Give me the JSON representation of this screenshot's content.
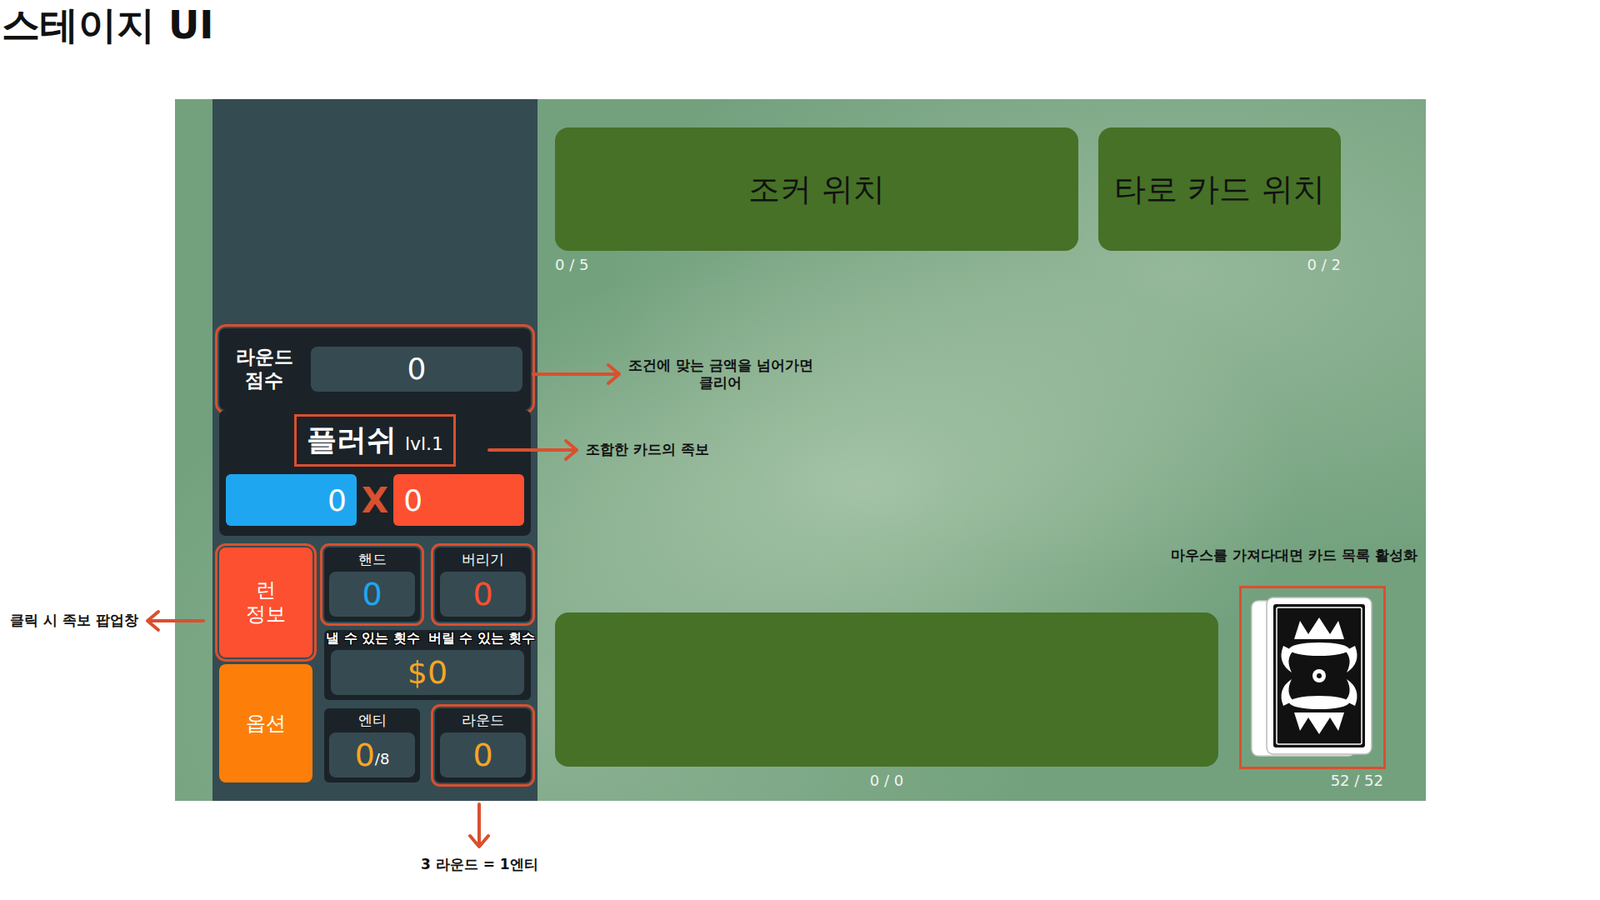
{
  "page": {
    "title": "스테이지 UI"
  },
  "board": {
    "joker_slot": {
      "label": "조커 위치",
      "count": "0 / 5"
    },
    "tarot_slot": {
      "label": "타로 카드 위치",
      "count": "0 / 2"
    },
    "hand_area": {
      "count": "0 / 0"
    },
    "deck": {
      "count": "52 / 52",
      "highlighted": true
    }
  },
  "sidebar": {
    "round_score": {
      "label_lines": [
        "라운드",
        "점수"
      ],
      "value": "0",
      "highlighted": true
    },
    "poker_hand": {
      "name": "플러쉬",
      "level": "lvl.1",
      "highlighted": true,
      "chips": "0",
      "times": "X",
      "mult": "0"
    },
    "run_info": {
      "label_lines": [
        "런",
        "정보"
      ],
      "highlighted": true
    },
    "options": {
      "label": "옵션",
      "highlighted": false
    },
    "hands": {
      "label": "핸드",
      "value": "0",
      "caption": "낼 수 있는 횟수",
      "highlighted": true
    },
    "discards": {
      "label": "버리기",
      "value": "0",
      "caption": "버릴 수 있는 횟수",
      "highlighted": true
    },
    "money": {
      "value": "$0"
    },
    "ante": {
      "label": "엔티",
      "value": "0",
      "max": "/8",
      "highlighted": false
    },
    "round": {
      "label": "라운드",
      "value": "0",
      "highlighted": true
    }
  },
  "annotations": [
    {
      "lines": [
        "조건에 맞는 금액을 넘어가면",
        "클리어"
      ]
    },
    {
      "lines": [
        "조합한 카드의 족보"
      ]
    },
    {
      "lines": [
        "클릭 시 족보 팝업창"
      ]
    },
    {
      "lines": [
        "3 라운드 = 1엔티"
      ]
    },
    {
      "lines": [
        "마우스를 가져다대면 카드 목록 활성화"
      ]
    }
  ]
}
